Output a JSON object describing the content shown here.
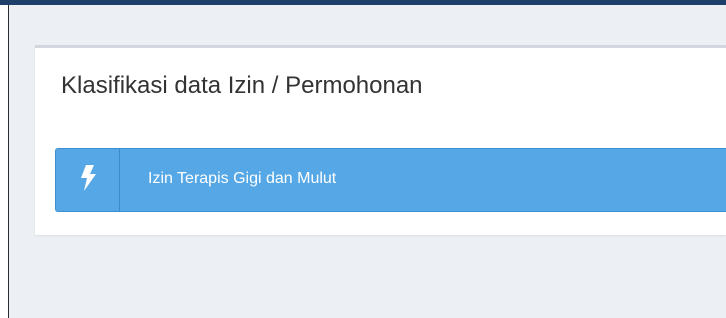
{
  "panel": {
    "title": "Klasifikasi data Izin / Permohonan"
  },
  "items": [
    {
      "label": "Izin Terapis Gigi dan Mulut",
      "icon": "bolt-icon"
    }
  ],
  "colors": {
    "item_background": "#55a7e5",
    "page_background": "#ecf0f5",
    "top_bar": "#1f3f6b"
  }
}
